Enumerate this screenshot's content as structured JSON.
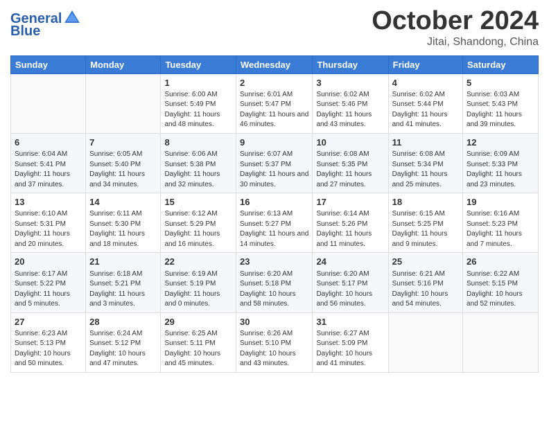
{
  "logo": {
    "text_general": "General",
    "text_blue": "Blue"
  },
  "title": "October 2024",
  "subtitle": "Jitai, Shandong, China",
  "days_of_week": [
    "Sunday",
    "Monday",
    "Tuesday",
    "Wednesday",
    "Thursday",
    "Friday",
    "Saturday"
  ],
  "weeks": [
    [
      {
        "day": "",
        "sunrise": "",
        "sunset": "",
        "daylight": ""
      },
      {
        "day": "",
        "sunrise": "",
        "sunset": "",
        "daylight": ""
      },
      {
        "day": "1",
        "sunrise": "Sunrise: 6:00 AM",
        "sunset": "Sunset: 5:49 PM",
        "daylight": "Daylight: 11 hours and 48 minutes."
      },
      {
        "day": "2",
        "sunrise": "Sunrise: 6:01 AM",
        "sunset": "Sunset: 5:47 PM",
        "daylight": "Daylight: 11 hours and 46 minutes."
      },
      {
        "day": "3",
        "sunrise": "Sunrise: 6:02 AM",
        "sunset": "Sunset: 5:46 PM",
        "daylight": "Daylight: 11 hours and 43 minutes."
      },
      {
        "day": "4",
        "sunrise": "Sunrise: 6:02 AM",
        "sunset": "Sunset: 5:44 PM",
        "daylight": "Daylight: 11 hours and 41 minutes."
      },
      {
        "day": "5",
        "sunrise": "Sunrise: 6:03 AM",
        "sunset": "Sunset: 5:43 PM",
        "daylight": "Daylight: 11 hours and 39 minutes."
      }
    ],
    [
      {
        "day": "6",
        "sunrise": "Sunrise: 6:04 AM",
        "sunset": "Sunset: 5:41 PM",
        "daylight": "Daylight: 11 hours and 37 minutes."
      },
      {
        "day": "7",
        "sunrise": "Sunrise: 6:05 AM",
        "sunset": "Sunset: 5:40 PM",
        "daylight": "Daylight: 11 hours and 34 minutes."
      },
      {
        "day": "8",
        "sunrise": "Sunrise: 6:06 AM",
        "sunset": "Sunset: 5:38 PM",
        "daylight": "Daylight: 11 hours and 32 minutes."
      },
      {
        "day": "9",
        "sunrise": "Sunrise: 6:07 AM",
        "sunset": "Sunset: 5:37 PM",
        "daylight": "Daylight: 11 hours and 30 minutes."
      },
      {
        "day": "10",
        "sunrise": "Sunrise: 6:08 AM",
        "sunset": "Sunset: 5:35 PM",
        "daylight": "Daylight: 11 hours and 27 minutes."
      },
      {
        "day": "11",
        "sunrise": "Sunrise: 6:08 AM",
        "sunset": "Sunset: 5:34 PM",
        "daylight": "Daylight: 11 hours and 25 minutes."
      },
      {
        "day": "12",
        "sunrise": "Sunrise: 6:09 AM",
        "sunset": "Sunset: 5:33 PM",
        "daylight": "Daylight: 11 hours and 23 minutes."
      }
    ],
    [
      {
        "day": "13",
        "sunrise": "Sunrise: 6:10 AM",
        "sunset": "Sunset: 5:31 PM",
        "daylight": "Daylight: 11 hours and 20 minutes."
      },
      {
        "day": "14",
        "sunrise": "Sunrise: 6:11 AM",
        "sunset": "Sunset: 5:30 PM",
        "daylight": "Daylight: 11 hours and 18 minutes."
      },
      {
        "day": "15",
        "sunrise": "Sunrise: 6:12 AM",
        "sunset": "Sunset: 5:29 PM",
        "daylight": "Daylight: 11 hours and 16 minutes."
      },
      {
        "day": "16",
        "sunrise": "Sunrise: 6:13 AM",
        "sunset": "Sunset: 5:27 PM",
        "daylight": "Daylight: 11 hours and 14 minutes."
      },
      {
        "day": "17",
        "sunrise": "Sunrise: 6:14 AM",
        "sunset": "Sunset: 5:26 PM",
        "daylight": "Daylight: 11 hours and 11 minutes."
      },
      {
        "day": "18",
        "sunrise": "Sunrise: 6:15 AM",
        "sunset": "Sunset: 5:25 PM",
        "daylight": "Daylight: 11 hours and 9 minutes."
      },
      {
        "day": "19",
        "sunrise": "Sunrise: 6:16 AM",
        "sunset": "Sunset: 5:23 PM",
        "daylight": "Daylight: 11 hours and 7 minutes."
      }
    ],
    [
      {
        "day": "20",
        "sunrise": "Sunrise: 6:17 AM",
        "sunset": "Sunset: 5:22 PM",
        "daylight": "Daylight: 11 hours and 5 minutes."
      },
      {
        "day": "21",
        "sunrise": "Sunrise: 6:18 AM",
        "sunset": "Sunset: 5:21 PM",
        "daylight": "Daylight: 11 hours and 3 minutes."
      },
      {
        "day": "22",
        "sunrise": "Sunrise: 6:19 AM",
        "sunset": "Sunset: 5:19 PM",
        "daylight": "Daylight: 11 hours and 0 minutes."
      },
      {
        "day": "23",
        "sunrise": "Sunrise: 6:20 AM",
        "sunset": "Sunset: 5:18 PM",
        "daylight": "Daylight: 10 hours and 58 minutes."
      },
      {
        "day": "24",
        "sunrise": "Sunrise: 6:20 AM",
        "sunset": "Sunset: 5:17 PM",
        "daylight": "Daylight: 10 hours and 56 minutes."
      },
      {
        "day": "25",
        "sunrise": "Sunrise: 6:21 AM",
        "sunset": "Sunset: 5:16 PM",
        "daylight": "Daylight: 10 hours and 54 minutes."
      },
      {
        "day": "26",
        "sunrise": "Sunrise: 6:22 AM",
        "sunset": "Sunset: 5:15 PM",
        "daylight": "Daylight: 10 hours and 52 minutes."
      }
    ],
    [
      {
        "day": "27",
        "sunrise": "Sunrise: 6:23 AM",
        "sunset": "Sunset: 5:13 PM",
        "daylight": "Daylight: 10 hours and 50 minutes."
      },
      {
        "day": "28",
        "sunrise": "Sunrise: 6:24 AM",
        "sunset": "Sunset: 5:12 PM",
        "daylight": "Daylight: 10 hours and 47 minutes."
      },
      {
        "day": "29",
        "sunrise": "Sunrise: 6:25 AM",
        "sunset": "Sunset: 5:11 PM",
        "daylight": "Daylight: 10 hours and 45 minutes."
      },
      {
        "day": "30",
        "sunrise": "Sunrise: 6:26 AM",
        "sunset": "Sunset: 5:10 PM",
        "daylight": "Daylight: 10 hours and 43 minutes."
      },
      {
        "day": "31",
        "sunrise": "Sunrise: 6:27 AM",
        "sunset": "Sunset: 5:09 PM",
        "daylight": "Daylight: 10 hours and 41 minutes."
      },
      {
        "day": "",
        "sunrise": "",
        "sunset": "",
        "daylight": ""
      },
      {
        "day": "",
        "sunrise": "",
        "sunset": "",
        "daylight": ""
      }
    ]
  ]
}
